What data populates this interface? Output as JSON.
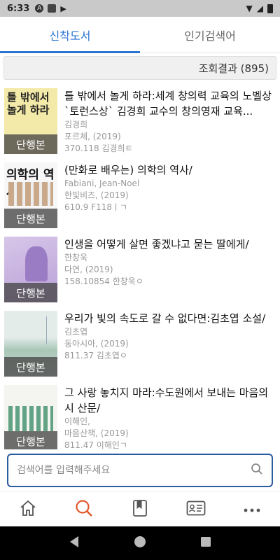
{
  "status": {
    "time": "6:33"
  },
  "tabs": [
    {
      "label": "신착도서"
    },
    {
      "label": "인기검색어"
    }
  ],
  "result": {
    "text": "조회결과 (895)"
  },
  "books": [
    {
      "title": "틀 밖에서 놀게 하라:세계 창의력 교육의 노벨상 `토런스상` 김경희 교수의 창의영재 교육...",
      "author": "김경희",
      "publisher": "포르체, (2019)",
      "callno": "370.118 김경희ㅌ",
      "badge": "단행본",
      "cover_text": "틀 밖에서 놀게 하라"
    },
    {
      "title": "(만화로 배우는) 의학의 역사/",
      "author": "Fabiani, Jean-Noel",
      "publisher": "한빛비즈, (2019)",
      "callno": "610.9 F118ㅣㄱ",
      "badge": "단행본",
      "cover_text": "의학의 역사"
    },
    {
      "title": "인생을 어떻게 살면 좋겠냐고 묻는 딸에게/",
      "author": "한창욱",
      "publisher": "다연, (2019)",
      "callno": "158.10854 한창욱ㅇ",
      "badge": "단행본",
      "cover_text": ""
    },
    {
      "title": "우리가 빛의 속도로 갈 수 없다면:김초엽 소설/",
      "author": "김초엽",
      "publisher": "동아시아, (2019)",
      "callno": "811.37 김초엽ㅇ",
      "badge": "단행본",
      "cover_text": ""
    },
    {
      "title": "그 사랑 놓치지 마라:수도원에서 보내는 마음의 시 산문/",
      "author": "이해인,",
      "publisher": "마음산책, (2019)",
      "callno": "811.47 이해인ㄱ",
      "badge": "단행본",
      "cover_text": ""
    }
  ],
  "search": {
    "placeholder": "검색어를 입력해주세요"
  },
  "nav": [
    {
      "icon": "home-icon"
    },
    {
      "icon": "search-icon"
    },
    {
      "icon": "book-icon"
    },
    {
      "icon": "id-card-icon"
    },
    {
      "icon": "more-icon"
    }
  ],
  "colors": {
    "accent": "#2a76d2",
    "search_active": "#e2572b",
    "search_border": "#2a5aa0"
  }
}
